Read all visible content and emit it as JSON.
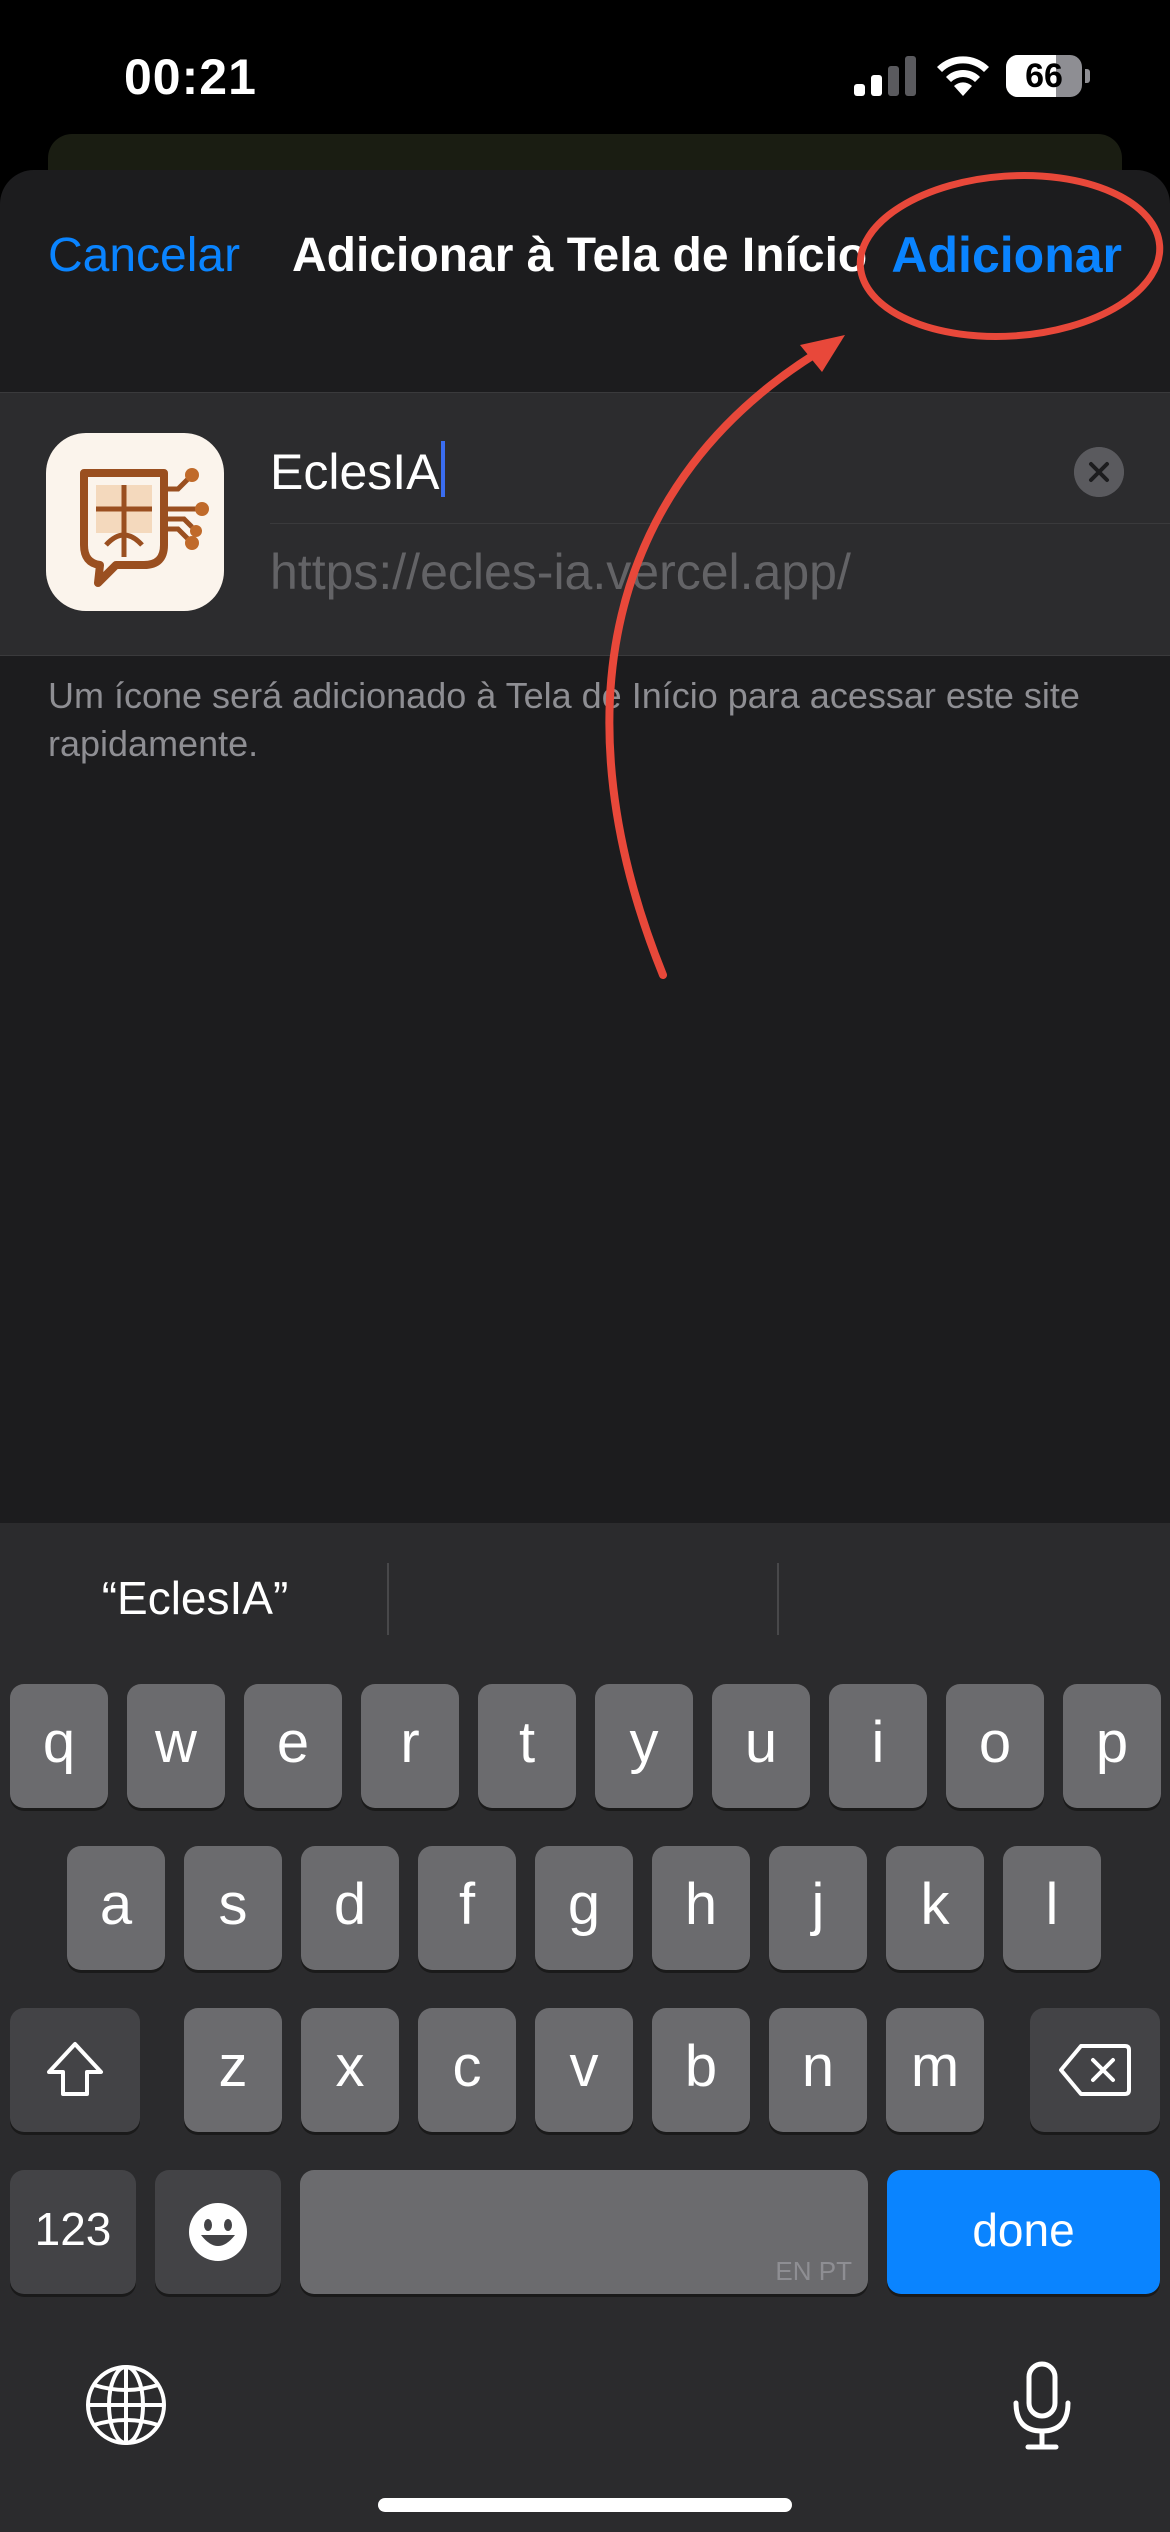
{
  "status_bar": {
    "time": "00:21",
    "battery_level": "66",
    "battery_fraction": 0.66
  },
  "sheet": {
    "cancel_label": "Cancelar",
    "title": "Adicionar à Tela de Início",
    "add_label": "Adicionar",
    "app_name_value": "EclesIA",
    "url": "https://ecles-ia.vercel.app/",
    "footnote": "Um ícone será adicionado à Tela de Início para acessar este site rapidamente."
  },
  "keyboard": {
    "suggestions": [
      "“EclesIA”",
      "",
      ""
    ],
    "row1": [
      "q",
      "w",
      "e",
      "r",
      "t",
      "y",
      "u",
      "i",
      "o",
      "p"
    ],
    "row2": [
      "a",
      "s",
      "d",
      "f",
      "g",
      "h",
      "j",
      "k",
      "l"
    ],
    "row3": [
      "z",
      "x",
      "c",
      "v",
      "b",
      "n",
      "m"
    ],
    "numbers_label": "123",
    "language_indicator": "EN PT",
    "done_label": "done"
  },
  "icons": {
    "signal": "cellular-signal-icon",
    "wifi": "wifi-icon",
    "clear": "clear-text-icon",
    "shift": "shift-arrow-icon",
    "delete": "backspace-icon",
    "emoji": "emoji-face-icon",
    "globe": "globe-icon",
    "mic": "microphone-icon"
  },
  "colors": {
    "accent": "#0a84ff",
    "annotation": "#e8483a",
    "app_icon_brown": "#9a4f20"
  }
}
